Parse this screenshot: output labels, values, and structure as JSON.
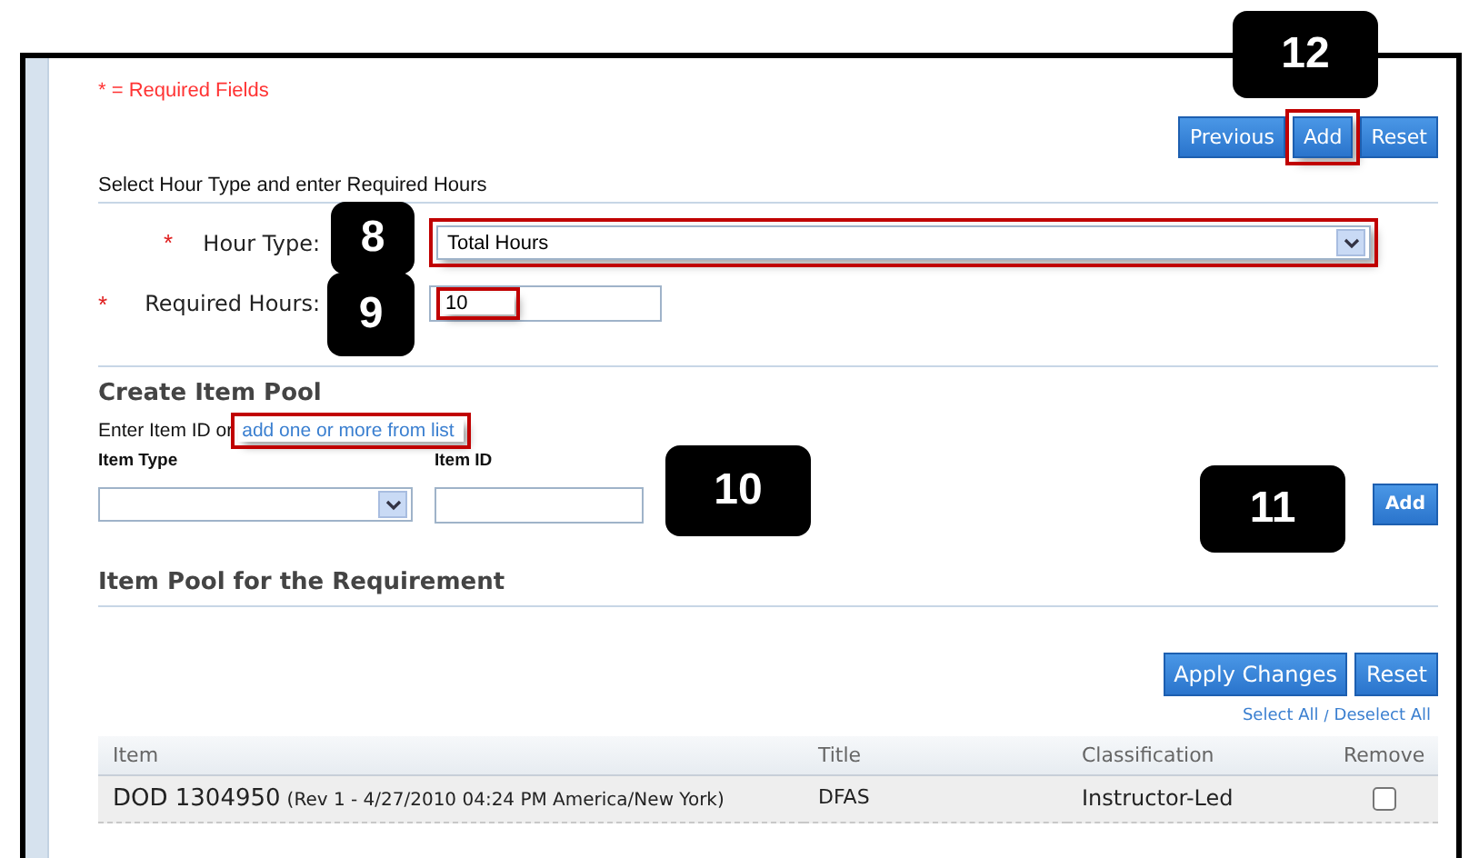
{
  "required_note": "* = Required Fields",
  "top_buttons": [
    {
      "label": "Previous",
      "highlighted": false
    },
    {
      "label": "Add",
      "highlighted": true
    },
    {
      "label": "Reset",
      "highlighted": false
    }
  ],
  "hours_section": {
    "instruction": "Select Hour Type and enter Required Hours",
    "hour_type": {
      "required_mark": "*",
      "label": "Hour Type:",
      "value": "Total Hours",
      "highlighted": true
    },
    "required_hours": {
      "required_mark": "*",
      "label": "Required Hours:",
      "value": "10",
      "highlighted": true
    }
  },
  "create_item_pool": {
    "title": "Create Item Pool",
    "intro": "Enter Item ID or",
    "link": "add one or more from list",
    "link_highlighted": true,
    "item_type_label": "Item Type",
    "item_id_label": "Item ID",
    "add_button": "Add"
  },
  "item_pool": {
    "title": "Item Pool for the Requirement",
    "buttons": [
      "Apply Changes",
      "Reset"
    ],
    "select_all": "Select All",
    "separator": "/",
    "deselect_all": "Deselect All",
    "columns": [
      "Item",
      "Title",
      "Classification",
      "Remove"
    ],
    "rows": [
      {
        "item_code": "DOD 1304950",
        "item_rev": "(Rev 1 - 4/27/2010 04:24 PM America/New York)",
        "title": "DFAS",
        "classification": "Instructor-Led",
        "remove": false
      }
    ]
  },
  "callouts": [
    "8",
    "9",
    "10",
    "11",
    "12"
  ]
}
